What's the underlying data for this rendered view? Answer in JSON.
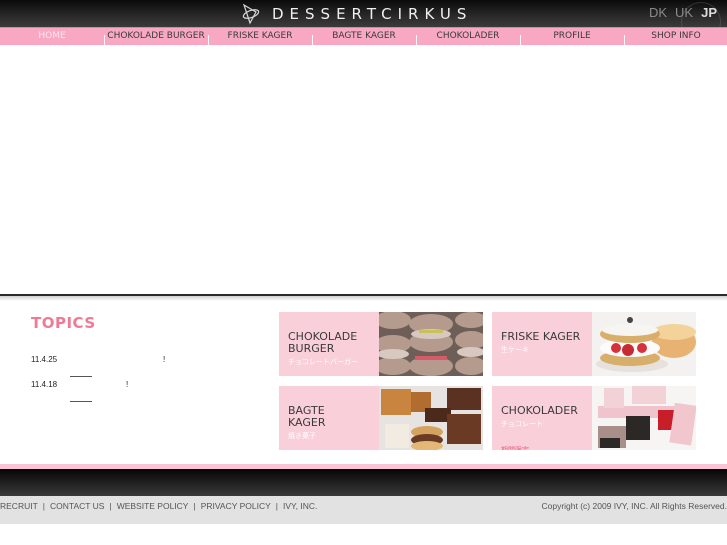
{
  "header": {
    "brand": "DESSERTCIRKUS",
    "languages": [
      {
        "code": "DK",
        "active": false
      },
      {
        "code": "UK",
        "active": false
      },
      {
        "code": "JP",
        "active": true
      }
    ]
  },
  "nav": {
    "items": [
      {
        "label": "HOME"
      },
      {
        "label": "CHOKOLADE BURGER"
      },
      {
        "label": "FRISKE KAGER"
      },
      {
        "label": "BAGTE KAGER"
      },
      {
        "label": "CHOKOLADER"
      },
      {
        "label": "PROFILE"
      },
      {
        "label": "SHOP INFO"
      }
    ]
  },
  "topics": {
    "title": "TOPICS",
    "items": [
      {
        "date": "11.4.25",
        "text": "!"
      },
      {
        "date": "11.4.18",
        "text": "!"
      }
    ]
  },
  "categories": [
    {
      "title": "CHOKOLADE\nBURGER",
      "jp": "チョコレートバーガー",
      "jp2": ""
    },
    {
      "title": "FRISKE KAGER",
      "jp": "生ケーキ",
      "jp2": ""
    },
    {
      "title": "BAGTE\nKAGER",
      "jp": "焼き菓子",
      "jp2": ""
    },
    {
      "title": "CHOKOLADER",
      "jp": "チョコレート",
      "jp2": "期間限定"
    }
  ],
  "footer": {
    "links": [
      "RECRUIT",
      "CONTACT US",
      "WEBSITE POLICY",
      "PRIVACY POLICY",
      "IVY, INC."
    ],
    "separator": "|",
    "copyright": "Copyright (c) 2009 IVY, INC. All Rights Reserved."
  },
  "colors": {
    "nav_bg": "#f9a8c4",
    "tile_bg": "#f9d0d9",
    "topics_title": "#ee7a93",
    "footer_bg": "#e2e2e2"
  }
}
